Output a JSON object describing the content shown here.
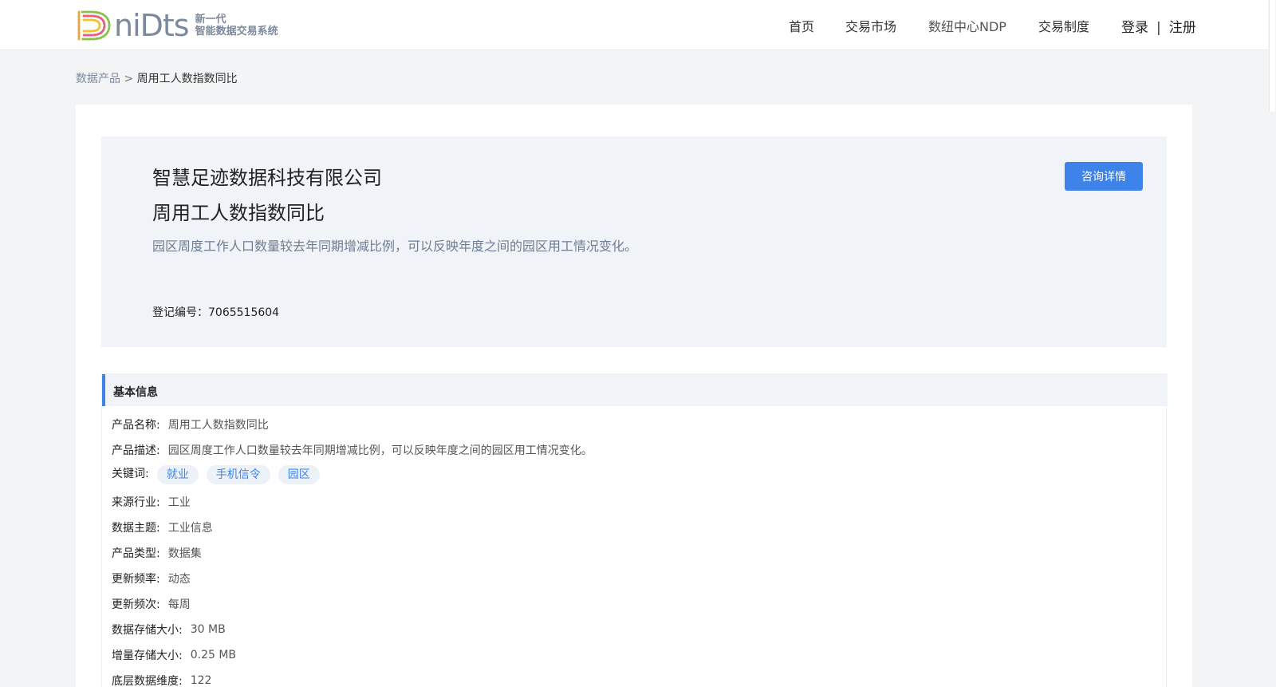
{
  "header": {
    "logo_word": "niDts",
    "logo_sub_line1": "新一代",
    "logo_sub_line2": "智能数据交易系统",
    "nav": [
      "首页",
      "交易市场",
      "数纽中心NDP",
      "交易制度"
    ],
    "login": "登录",
    "separator": "|",
    "register": "注册"
  },
  "breadcrumb": {
    "parent": "数据产品",
    "separator": ">",
    "current": "周用工人数指数同比"
  },
  "hero": {
    "company": "智慧足迹数据科技有限公司",
    "product": "周用工人数指数同比",
    "description": "园区周度工作人口数量较去年同期增减比例，可以反映年度之间的园区用工情况变化。",
    "reg_label": "登记编号：",
    "reg_number": "7065515604",
    "consult_button": "咨询详情"
  },
  "basic_info": {
    "title": "基本信息",
    "rows": [
      {
        "label": "产品名称:",
        "value": "周用工人数指数同比"
      },
      {
        "label": "产品描述:",
        "value": "园区周度工作人口数量较去年同期增减比例，可以反映年度之间的园区用工情况变化。"
      },
      {
        "label": "关键词:",
        "tags": [
          "就业",
          "手机信令",
          "园区"
        ]
      },
      {
        "label": "来源行业:",
        "value": "工业"
      },
      {
        "label": "数据主题:",
        "value": "工业信息"
      },
      {
        "label": "产品类型:",
        "value": "数据集"
      },
      {
        "label": "更新频率:",
        "value": "动态"
      },
      {
        "label": "更新频次:",
        "value": "每周"
      },
      {
        "label": "数据存储大小:",
        "value": "30 MB"
      },
      {
        "label": "增量存储大小:",
        "value": "0.25 MB"
      },
      {
        "label": "底层数据维度:",
        "value": "122"
      }
    ]
  },
  "colors": {
    "accent": "#3d83ea",
    "hero_bg": "#f0f3f7",
    "page_bg": "#f3f4f5"
  }
}
